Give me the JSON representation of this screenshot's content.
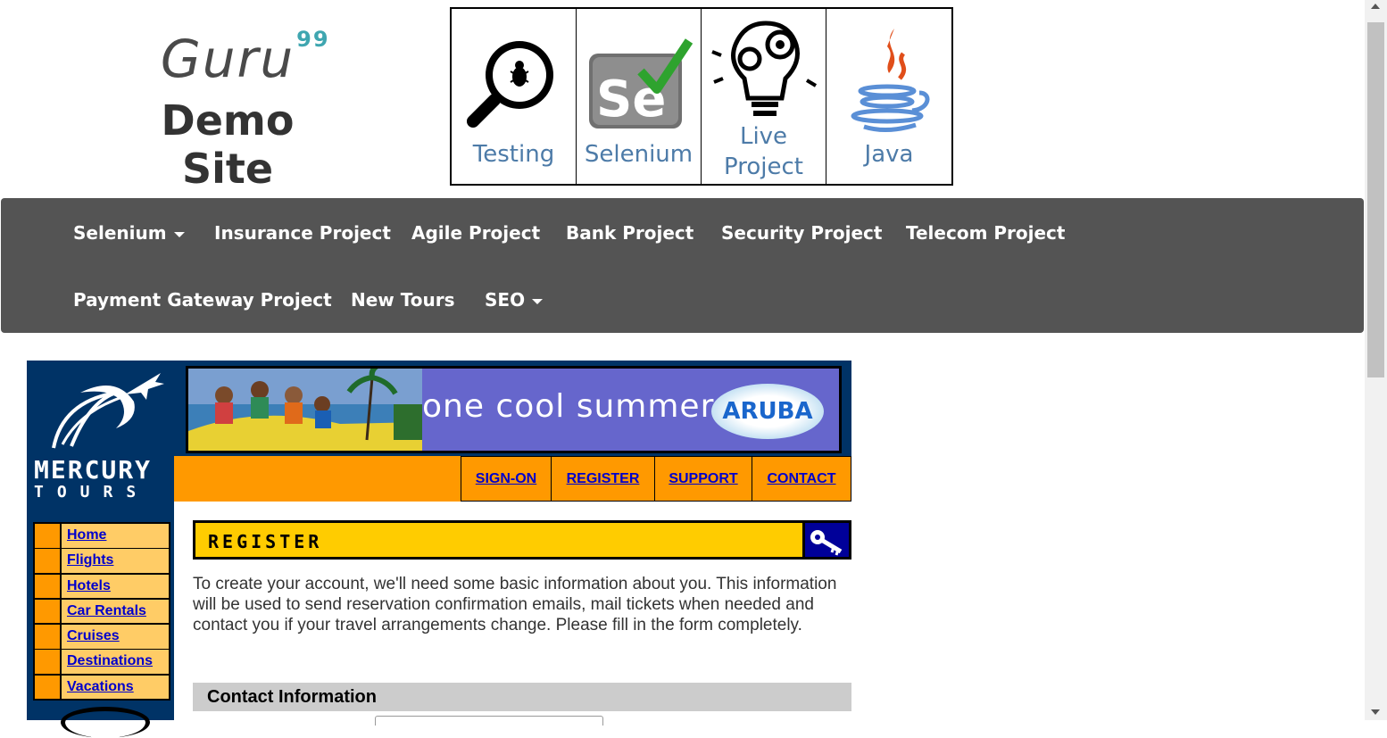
{
  "header": {
    "logo_text": "Guru",
    "logo_sup": "99",
    "site_title": "Demo Site"
  },
  "tiles": [
    {
      "label": "Testing",
      "icon": "magnifier-bug-icon"
    },
    {
      "label": "Selenium",
      "icon": "selenium-check-icon"
    },
    {
      "label": "Live\nProject",
      "icon": "lightbulb-gears-icon"
    },
    {
      "label": "Java",
      "icon": "java-cup-icon"
    }
  ],
  "nav": {
    "row1": [
      "Selenium",
      "Insurance Project",
      "Agile Project",
      "Bank Project",
      "Security Project",
      "Telecom Project"
    ],
    "row2": [
      "Payment Gateway Project",
      "New Tours",
      "SEO"
    ]
  },
  "mercury": {
    "logo_line1": "MERCURY",
    "logo_line2": "TOURS",
    "banner_text": "one cool summer",
    "banner_brand": "ARUBA",
    "top_links": [
      "SIGN-ON",
      "REGISTER",
      "SUPPORT",
      "CONTACT"
    ],
    "side_links": [
      "Home",
      "Flights",
      "Hotels",
      "Car Rentals",
      "Cruises",
      "Destinations",
      "Vacations"
    ],
    "section_title": "REGISTER",
    "intro": "To create your account, we'll need some basic information about you. This information will be used to send reservation confirmation emails, mail tickets when needed and contact you if your travel arrangements change. Please fill in the form completely.",
    "contact_heading": "Contact Information"
  },
  "colors": {
    "nav_bg": "#545454",
    "mercury_navy": "#003366",
    "mercury_orange": "#ff9900",
    "mercury_yellow": "#ffcc00",
    "link_blue": "#0000cc"
  }
}
